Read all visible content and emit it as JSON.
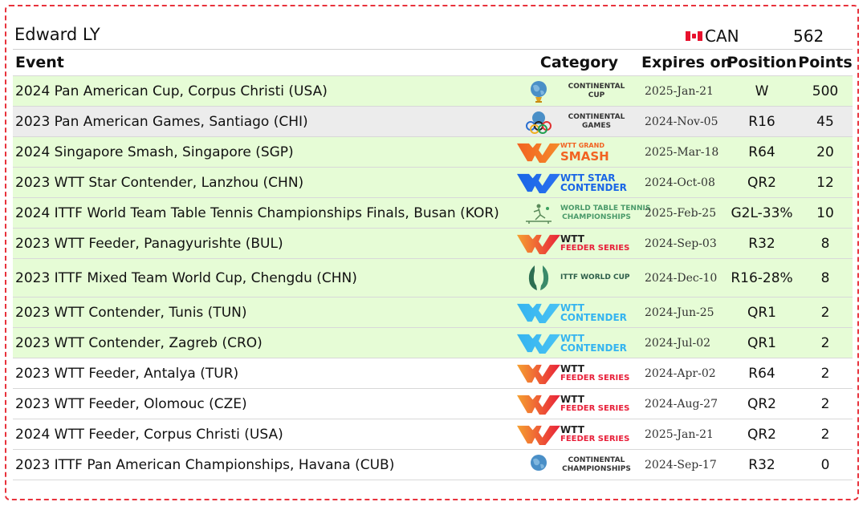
{
  "player": {
    "name": "Edward LY",
    "country": "CAN",
    "total_points": "562"
  },
  "table": {
    "headers": {
      "event": "Event",
      "category": "Category",
      "expires": "Expires on",
      "position": "Position",
      "points": "Points"
    },
    "rows": [
      {
        "event": "2024 Pan American Cup, Corpus Christi (USA)",
        "category": "CONTINENTAL CUP",
        "category_lines": [
          "CONTINENTAL",
          "CUP"
        ],
        "logo": "continental-cup-icon",
        "expires": "2025-Jan-21",
        "position": "W",
        "points": "500",
        "bg": "green"
      },
      {
        "event": "2023 Pan American Games, Santiago (CHI)",
        "category": "CONTINENTAL GAMES",
        "category_lines": [
          "CONTINENTAL",
          "GAMES"
        ],
        "logo": "continental-games-icon",
        "expires": "2024-Nov-05",
        "position": "R16",
        "points": "45",
        "bg": "grey"
      },
      {
        "event": "2024 Singapore Smash, Singapore (SGP)",
        "category": "WTT GRAND SMASH",
        "category_lines": [
          "WTT GRAND",
          "SMASH"
        ],
        "logo": "wtt-grand-smash-icon",
        "expires": "2025-Mar-18",
        "position": "R64",
        "points": "20",
        "bg": "green"
      },
      {
        "event": "2023 WTT Star Contender, Lanzhou (CHN)",
        "category": "WTT STAR CONTENDER",
        "category_lines": [
          "WTT STAR",
          "CONTENDER"
        ],
        "logo": "wtt-star-contender-icon",
        "expires": "2024-Oct-08",
        "position": "QR2",
        "points": "12",
        "bg": "green"
      },
      {
        "event": "2024 ITTF World Team Table Tennis Championships Finals, Busan (KOR)",
        "category": "WORLD TABLE TENNIS CHAMPIONSHIPS",
        "category_lines": [
          "WORLD TABLE TENNIS",
          "CHAMPIONSHIPS"
        ],
        "logo": "world-championships-icon",
        "expires": "2025-Feb-25",
        "position": "G2L-33%",
        "points": "10",
        "bg": "green"
      },
      {
        "event": "2023 WTT Feeder, Panagyurishte (BUL)",
        "category": "WTT FEEDER SERIES",
        "category_lines": [
          "WTT",
          "FEEDER SERIES"
        ],
        "logo": "wtt-feeder-icon",
        "expires": "2024-Sep-03",
        "position": "R32",
        "points": "8",
        "bg": "green"
      },
      {
        "event": "2023 ITTF Mixed Team World Cup, Chengdu (CHN)",
        "category": "ITTF WORLD CUP",
        "category_lines": [
          "ITTF WORLD CUP",
          ""
        ],
        "logo": "ittf-world-cup-icon",
        "expires": "2024-Dec-10",
        "position": "R16-28%",
        "points": "8",
        "bg": "green"
      },
      {
        "event": "2023 WTT Contender, Tunis (TUN)",
        "category": "WTT CONTENDER",
        "category_lines": [
          "WTT",
          "CONTENDER"
        ],
        "logo": "wtt-contender-icon",
        "expires": "2024-Jun-25",
        "position": "QR1",
        "points": "2",
        "bg": "green"
      },
      {
        "event": "2023 WTT Contender, Zagreb (CRO)",
        "category": "WTT CONTENDER",
        "category_lines": [
          "WTT",
          "CONTENDER"
        ],
        "logo": "wtt-contender-icon",
        "expires": "2024-Jul-02",
        "position": "QR1",
        "points": "2",
        "bg": "green"
      },
      {
        "event": "2023 WTT Feeder, Antalya (TUR)",
        "category": "WTT FEEDER SERIES",
        "category_lines": [
          "WTT",
          "FEEDER SERIES"
        ],
        "logo": "wtt-feeder-icon",
        "expires": "2024-Apr-02",
        "position": "R64",
        "points": "2",
        "bg": "white"
      },
      {
        "event": "2023 WTT Feeder, Olomouc (CZE)",
        "category": "WTT FEEDER SERIES",
        "category_lines": [
          "WTT",
          "FEEDER SERIES"
        ],
        "logo": "wtt-feeder-icon",
        "expires": "2024-Aug-27",
        "position": "QR2",
        "points": "2",
        "bg": "white"
      },
      {
        "event": "2024 WTT Feeder, Corpus Christi (USA)",
        "category": "WTT FEEDER SERIES",
        "category_lines": [
          "WTT",
          "FEEDER SERIES"
        ],
        "logo": "wtt-feeder-icon",
        "expires": "2025-Jan-21",
        "position": "QR2",
        "points": "2",
        "bg": "white"
      },
      {
        "event": "2023 ITTF Pan American Championships, Havana (CUB)",
        "category": "CONTINENTAL CHAMPIONSHIPS",
        "category_lines": [
          "CONTINENTAL",
          "CHAMPIONSHIPS"
        ],
        "logo": "continental-championships-icon",
        "expires": "2024-Sep-17",
        "position": "R32",
        "points": "0",
        "bg": "white"
      }
    ]
  },
  "colors": {
    "row_green": "#e6fcd6",
    "row_grey": "#ececec",
    "frame_border": "#e8323c",
    "feeder_red": "#e8203a",
    "smash_orange": "#f26322",
    "star_contender_blue": "#1a66e6",
    "contender_cyan": "#35b4f0",
    "world_cup_green": "#2d6e52"
  }
}
